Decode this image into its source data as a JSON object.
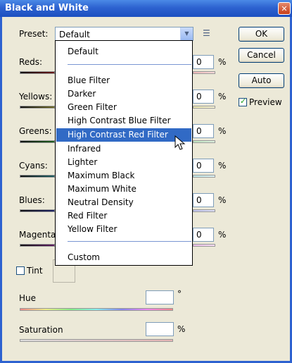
{
  "window": {
    "title": "Black and White"
  },
  "preset": {
    "label": "Preset:",
    "value": "Default",
    "options": [
      "Default",
      "Blue Filter",
      "Darker",
      "Green Filter",
      "High Contrast Blue Filter",
      "High Contrast Red Filter",
      "Infrared",
      "Lighter",
      "Maximum Black",
      "Maximum White",
      "Neutral Density",
      "Red Filter",
      "Yellow Filter",
      "Custom"
    ],
    "highlighted": "High Contrast Red Filter"
  },
  "buttons": {
    "ok": "OK",
    "cancel": "Cancel",
    "auto": "Auto"
  },
  "preview": {
    "label": "Preview",
    "checked": true
  },
  "channels": [
    {
      "label": "Reds:",
      "value": "0",
      "unit": "%"
    },
    {
      "label": "Yellows:",
      "value": "0",
      "unit": "%"
    },
    {
      "label": "Greens:",
      "value": "0",
      "unit": "%"
    },
    {
      "label": "Cyans:",
      "value": "0",
      "unit": "%"
    },
    {
      "label": "Blues:",
      "value": "0",
      "unit": "%"
    },
    {
      "label": "Magentas:",
      "value": "0",
      "unit": "%"
    }
  ],
  "tint": {
    "label": "Tint",
    "checked": false
  },
  "hue": {
    "label": "Hue",
    "value": "",
    "unit": "°"
  },
  "saturation": {
    "label": "Saturation",
    "value": "",
    "unit": "%"
  },
  "icons": {
    "close": "close-icon",
    "dropdown": "chevron-down-icon",
    "menu": "preset-options-icon",
    "cursor": "mouse-pointer-icon"
  },
  "colors": {
    "titlebar": "#2d62d0",
    "highlight": "#316ac5",
    "dialog_bg": "#ece9d8"
  }
}
